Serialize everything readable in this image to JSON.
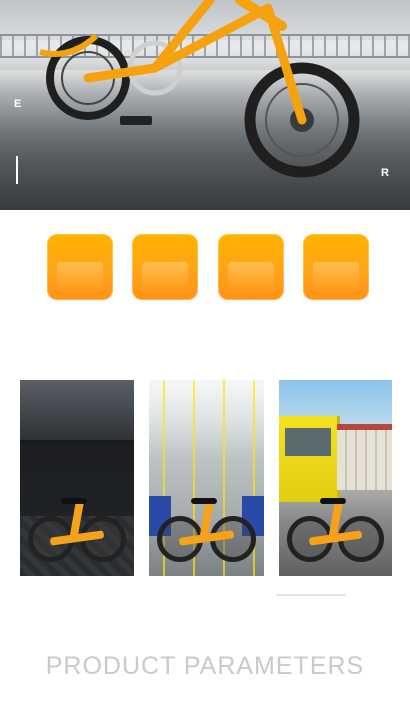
{
  "hero": {
    "left_letter": "E",
    "right_letter": "R"
  },
  "colors": {
    "accent_orange": "#FFA418",
    "title_gray": "#C9C9C9"
  },
  "tiles_count": 4,
  "photos": [
    {
      "scene": "car-trunk"
    },
    {
      "scene": "subway"
    },
    {
      "scene": "street"
    }
  ],
  "section": {
    "title": "PRODUCT PARAMETERS"
  }
}
